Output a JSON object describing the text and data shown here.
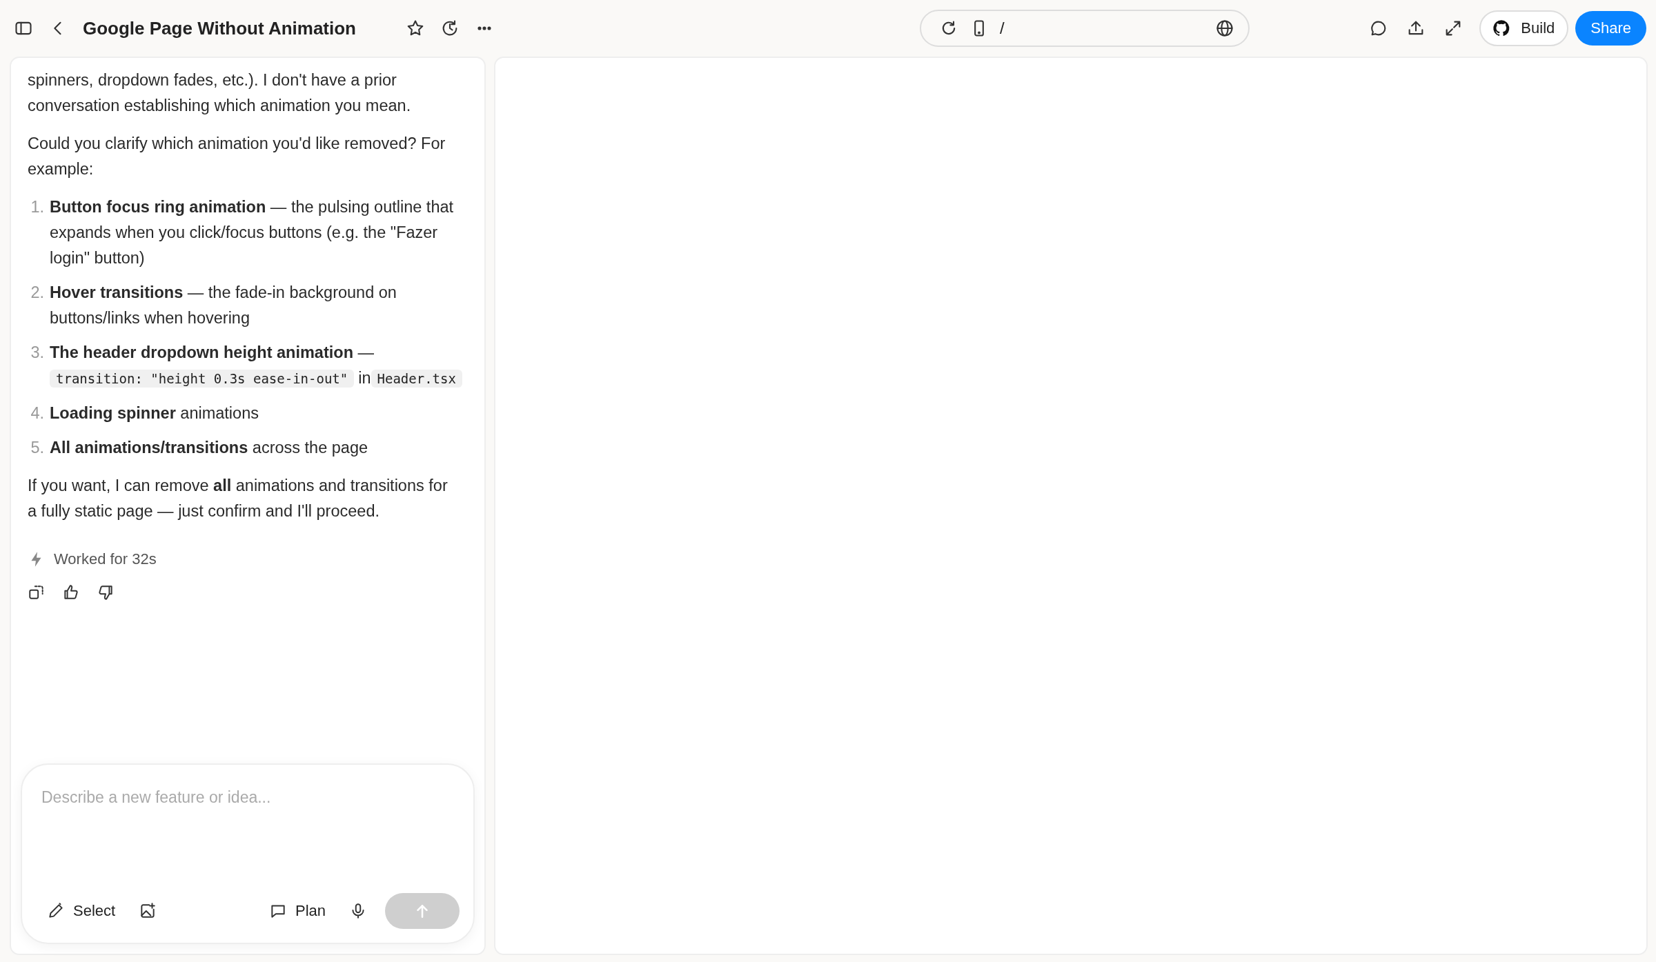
{
  "topbar": {
    "title": "Google Page Without Animation",
    "address": "/",
    "build_label": "Build",
    "share_label": "Share"
  },
  "chat": {
    "intro": [
      "spinners, dropdown fades, etc.). I don't have a prior conversation establishing which animation you mean.",
      "Could you clarify which animation you'd like removed? For example:"
    ],
    "list": [
      {
        "number": "1.",
        "parts": [
          {
            "kind": "text",
            "text": "**Button focus ring animation** — the pulsing outline that expands when you click/focus buttons (e.g. the \"Fazer login\" button)"
          }
        ]
      },
      {
        "number": "2.",
        "parts": [
          {
            "kind": "text",
            "text": "**Hover transitions** — the fade-in background on buttons/links when hovering"
          }
        ]
      },
      {
        "number": "3.",
        "parts": [
          {
            "kind": "text",
            "text": "**The header dropdown height animation** —"
          },
          {
            "kind": "code",
            "text": "transition: \"height 0.3s ease-in-out\""
          },
          {
            "kind": "text",
            "text": "in"
          },
          {
            "kind": "code",
            "text": "Header.tsx"
          }
        ]
      },
      {
        "number": "4.",
        "parts": [
          {
            "kind": "text",
            "text": "**Loading spinner** animations"
          }
        ]
      },
      {
        "number": "5.",
        "parts": [
          {
            "kind": "text",
            "text": "**All animations/transitions** across the page"
          }
        ]
      }
    ],
    "outro": [
      "If you want, I can remove **all** animations and transitions for a fully static page — just confirm and I'll proceed."
    ],
    "worked": "Worked for 32s"
  },
  "composer": {
    "placeholder": "Describe a new feature or idea...",
    "select_label": "Select",
    "plan_label": "Plan",
    "send_disabled": true
  }
}
